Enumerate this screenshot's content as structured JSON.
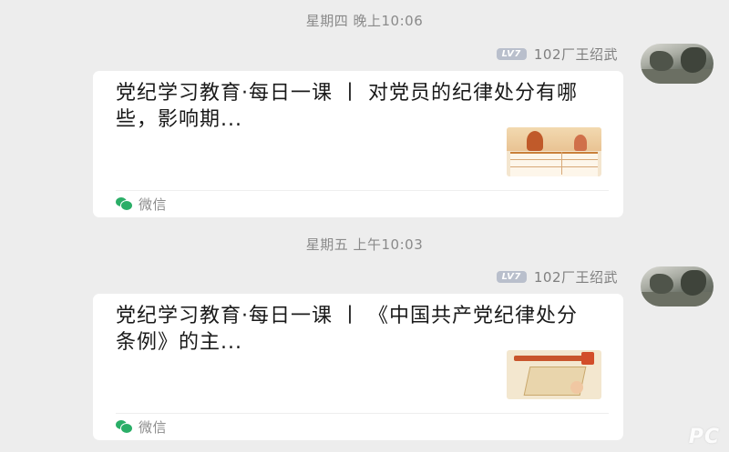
{
  "messages": [
    {
      "timestamp": "星期四 晚上10:06",
      "level_badge": "LV7",
      "sender": "102厂王绍武",
      "title": "党纪学习教育·每日一课 丨 对党员的纪律处分有哪些，影响期...",
      "source": "微信"
    },
    {
      "timestamp": "星期五 上午10:03",
      "level_badge": "LV7",
      "sender": "102厂王绍武",
      "title": "党纪学习教育·每日一课 丨 《中国共产党纪律处分条例》的主...",
      "source": "微信"
    }
  ],
  "watermark": "PC",
  "colors": {
    "background": "#ededed",
    "card": "#ffffff",
    "wechat_green": "#2aae67",
    "badge": "#b9bfcc"
  }
}
